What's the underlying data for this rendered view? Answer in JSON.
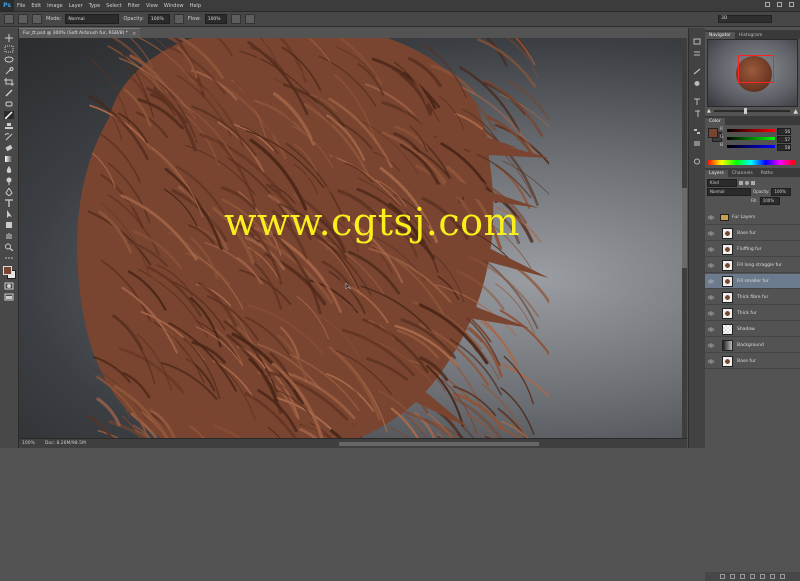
{
  "app": {
    "logo": "Ps"
  },
  "menu": [
    "File",
    "Edit",
    "Image",
    "Layer",
    "Type",
    "Select",
    "Filter",
    "View",
    "Window",
    "Help"
  ],
  "options": {
    "mode_label": "Mode:",
    "mode_value": "Normal",
    "opacity_label": "Opacity:",
    "opacity_value": "100%",
    "flow_label": "Flow:",
    "flow_value": "100%",
    "workspace": "3D"
  },
  "document": {
    "tab_title": "Fur_tt.psd @ 300% (Soft Airbrush fur, RGB/8) *",
    "close": "×"
  },
  "canvas": {
    "watermark": "www.cgtsj.com",
    "hair_color": "#7a4530",
    "hair_light": "#a8684a",
    "hair_dark": "#4a2718"
  },
  "status": {
    "zoom": "100%",
    "doc_size": "Doc: 8.26M/98.5M"
  },
  "panels": {
    "navigator_tabs": [
      "Navigator",
      "Histogram"
    ],
    "color_tabs": [
      "Color"
    ],
    "color_labels": [
      "R",
      "G",
      "B"
    ],
    "color_values": [
      "56",
      "57",
      "58"
    ],
    "layers_tabs": [
      "Layers",
      "Channels",
      "Paths"
    ],
    "filter_kind": "Kind",
    "blend_mode": "Normal",
    "opacity_label": "Opacity:",
    "opacity_value": "100%",
    "fill_label": "Fill:",
    "fill_value": "100%"
  },
  "layers": [
    {
      "name": "Fur Layers",
      "selected": false
    },
    {
      "name": "Base fur",
      "selected": false
    },
    {
      "name": "Fluffing fur",
      "selected": false
    },
    {
      "name": "Fill long straggle fur",
      "selected": false
    },
    {
      "name": "Fill smaller fur",
      "selected": true
    },
    {
      "name": "Thick fibre fur",
      "selected": false
    },
    {
      "name": "Thick fur",
      "selected": false
    },
    {
      "name": "Shadow",
      "selected": false
    },
    {
      "name": "Background",
      "selected": false
    },
    {
      "name": "Base fur",
      "selected": false
    }
  ]
}
